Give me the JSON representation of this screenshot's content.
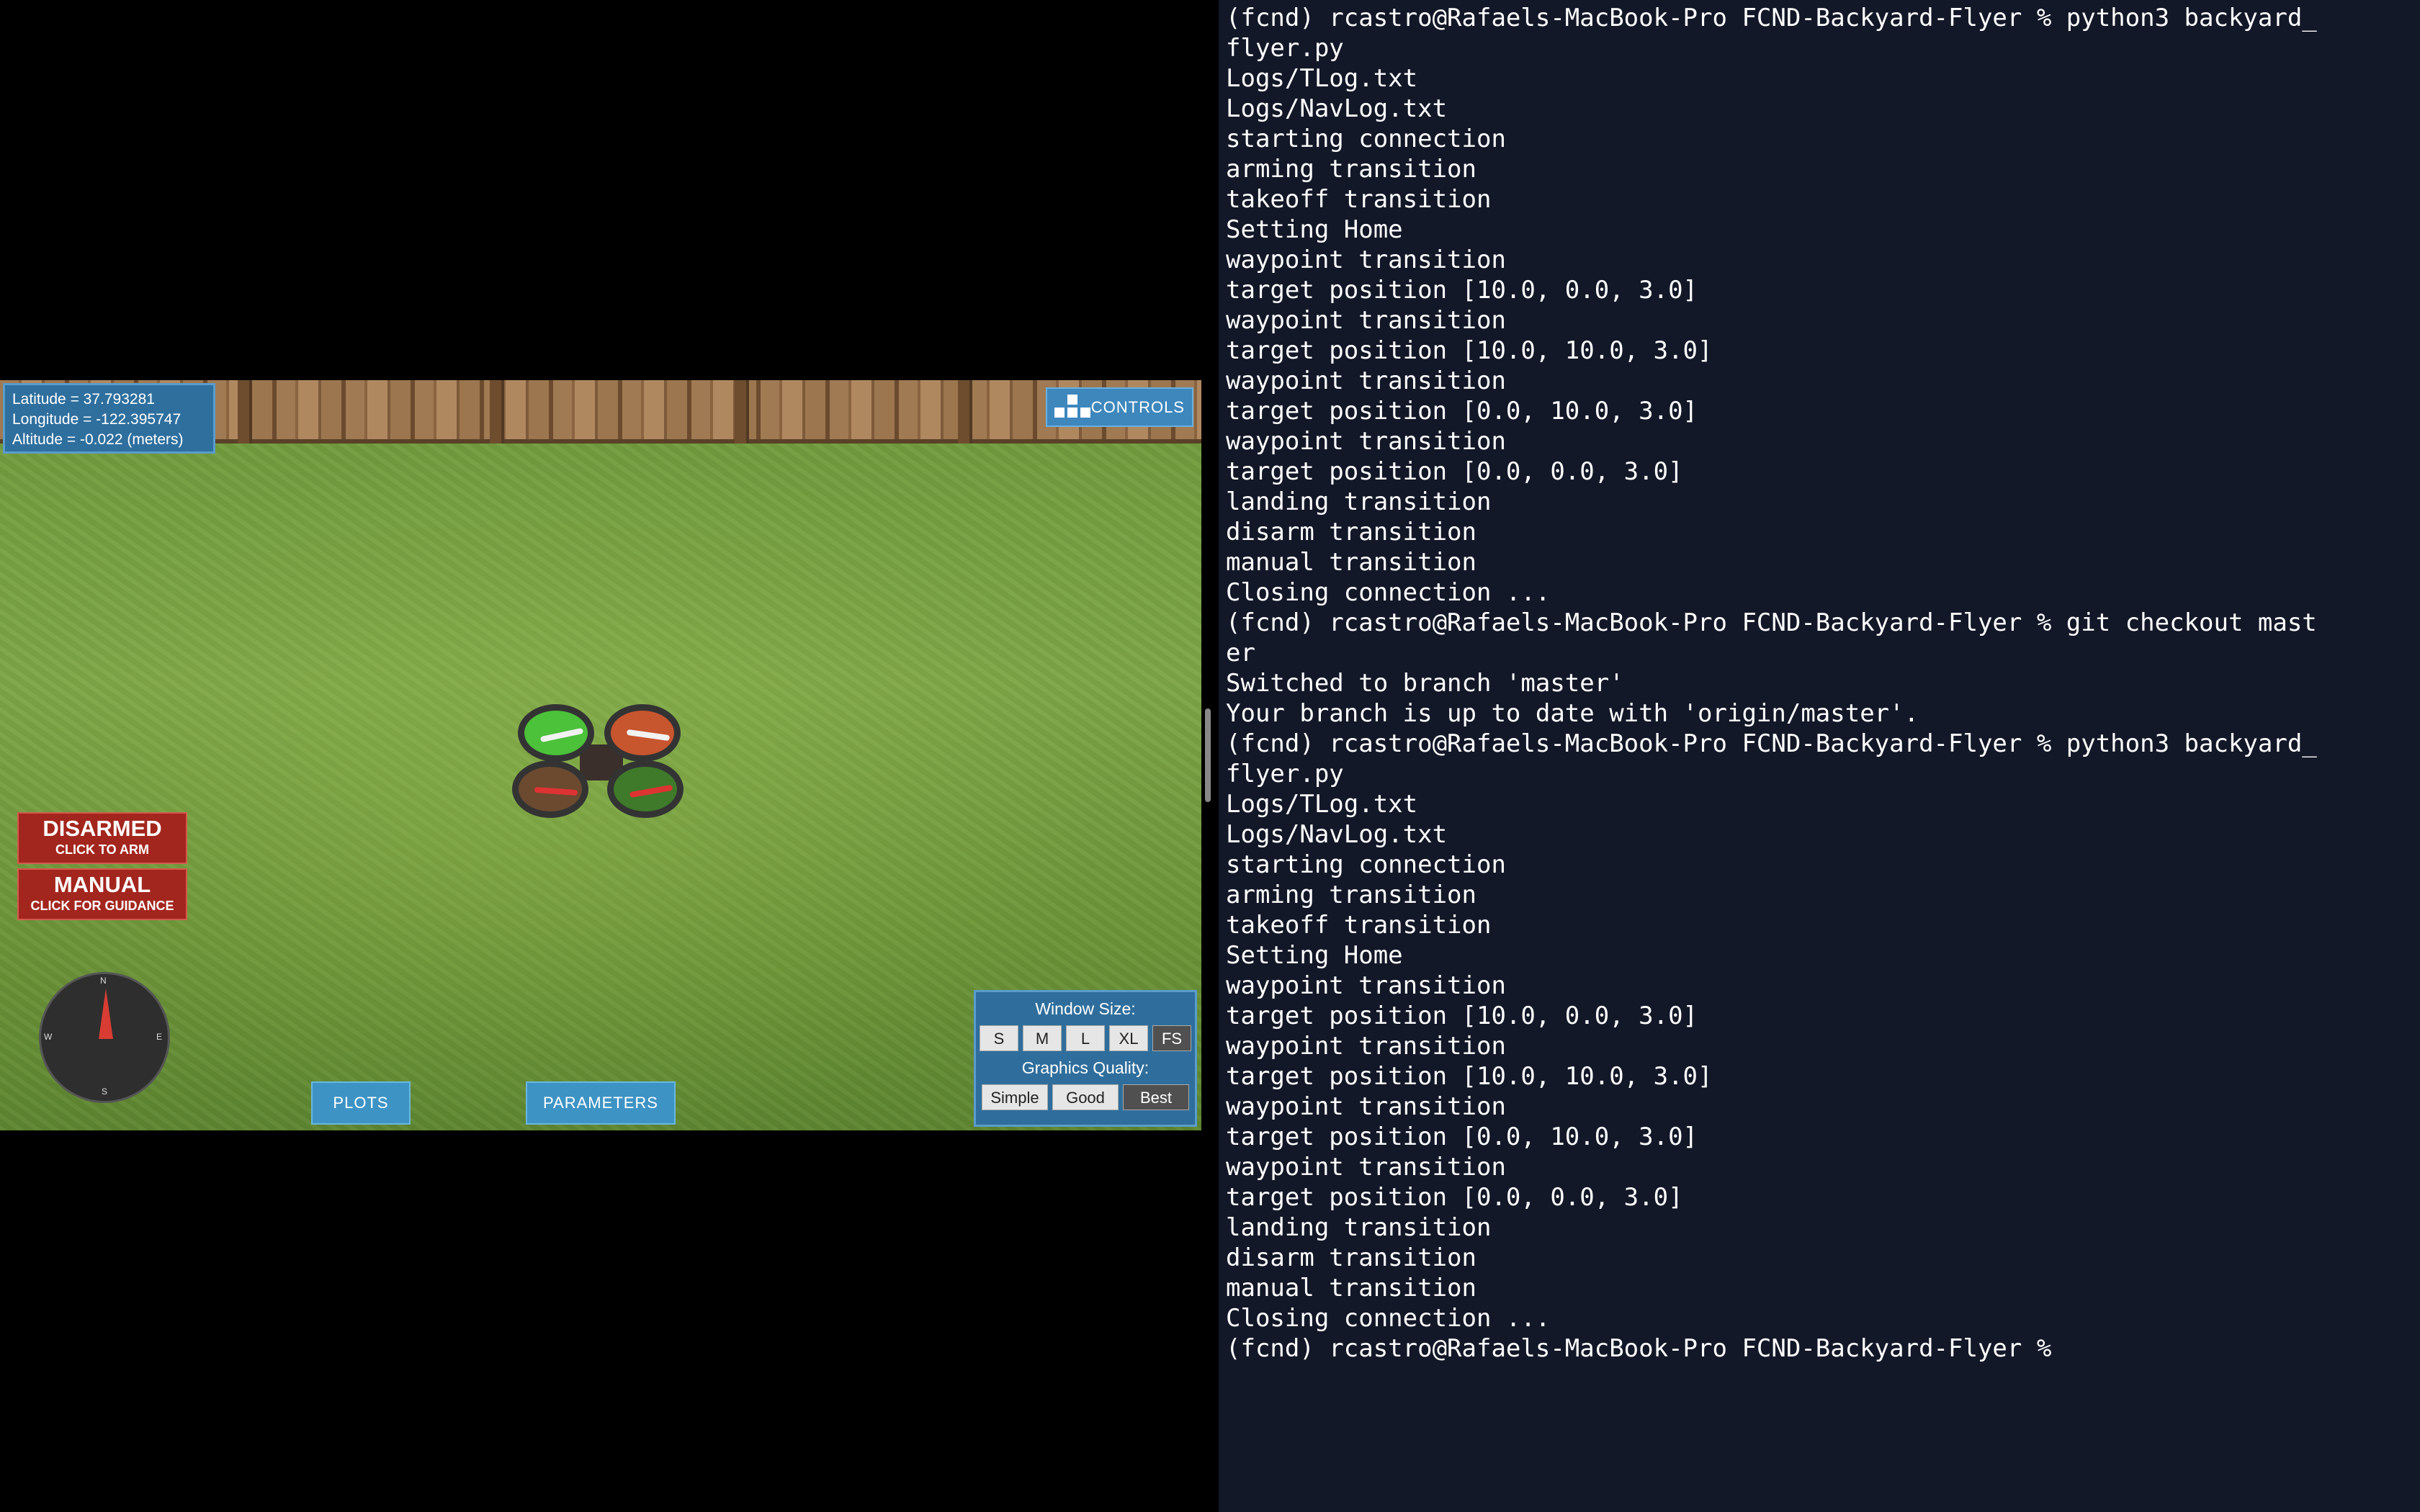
{
  "simulator": {
    "coords": {
      "latitude": "Latitude = 37.793281",
      "longitude": "Longitude = -122.395747",
      "altitude": "Altitude = -0.022 (meters)"
    },
    "controls_label": "CONTROLS",
    "arm_button": {
      "title": "DISARMED",
      "subtitle": "CLICK TO ARM"
    },
    "mode_button": {
      "title": "MANUAL",
      "subtitle": "CLICK FOR GUIDANCE"
    },
    "compass": {
      "n": "N",
      "s": "S",
      "e": "E",
      "w": "W"
    },
    "plots_label": "PLOTS",
    "parameters_label": "PARAMETERS",
    "window_size": {
      "label": "Window Size:",
      "options": [
        "S",
        "M",
        "L",
        "XL",
        "FS"
      ],
      "selected": "FS"
    },
    "graphics_quality": {
      "label": "Graphics Quality:",
      "options": [
        "Simple",
        "Good",
        "Best"
      ],
      "selected": "Best"
    },
    "colors": {
      "button_red": "#a3261e",
      "panel_blue": "#2e6f9e",
      "grass": "#7ea647"
    }
  },
  "terminal": {
    "background": "#131828",
    "lines": [
      "(fcnd) rcastro@Rafaels-MacBook-Pro FCND-Backyard-Flyer % python3 backyard_",
      "flyer.py",
      "Logs/TLog.txt",
      "Logs/NavLog.txt",
      "starting connection",
      "arming transition",
      "takeoff transition",
      "Setting Home",
      "waypoint transition",
      "target position [10.0, 0.0, 3.0]",
      "waypoint transition",
      "target position [10.0, 10.0, 3.0]",
      "waypoint transition",
      "target position [0.0, 10.0, 3.0]",
      "waypoint transition",
      "target position [0.0, 0.0, 3.0]",
      "landing transition",
      "disarm transition",
      "manual transition",
      "Closing connection ...",
      "(fcnd) rcastro@Rafaels-MacBook-Pro FCND-Backyard-Flyer % git checkout mast",
      "er",
      "Switched to branch 'master'",
      "Your branch is up to date with 'origin/master'.",
      "(fcnd) rcastro@Rafaels-MacBook-Pro FCND-Backyard-Flyer % python3 backyard_",
      "flyer.py",
      "Logs/TLog.txt",
      "Logs/NavLog.txt",
      "starting connection",
      "arming transition",
      "takeoff transition",
      "Setting Home",
      "waypoint transition",
      "target position [10.0, 0.0, 3.0]",
      "waypoint transition",
      "target position [10.0, 10.0, 3.0]",
      "waypoint transition",
      "target position [0.0, 10.0, 3.0]",
      "waypoint transition",
      "target position [0.0, 0.0, 3.0]",
      "landing transition",
      "disarm transition",
      "manual transition",
      "Closing connection ...",
      "(fcnd) rcastro@Rafaels-MacBook-Pro FCND-Backyard-Flyer %"
    ]
  }
}
